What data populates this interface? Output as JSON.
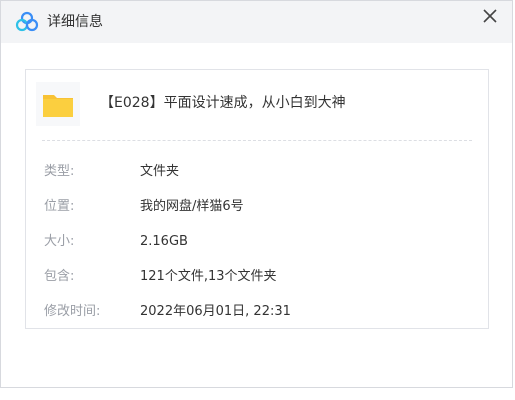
{
  "window": {
    "title": "详细信息",
    "logo_icon": "baidu-netdisk-cloud-icon",
    "close_icon": "close-icon",
    "brand_color": "#3a8ef6"
  },
  "file": {
    "icon": "folder-icon",
    "icon_color": "#f8c235",
    "name": "【E028】平面设计速成，从小白到大神"
  },
  "details": [
    {
      "label": "类型:",
      "value": "文件夹"
    },
    {
      "label": "位置:",
      "value": "我的网盘/样猫6号"
    },
    {
      "label": "大小:",
      "value": "2.16GB"
    },
    {
      "label": "包含:",
      "value": "121个文件,13个文件夹"
    },
    {
      "label": "修改时间:",
      "value": "2022年06月01日, 22:31"
    }
  ]
}
